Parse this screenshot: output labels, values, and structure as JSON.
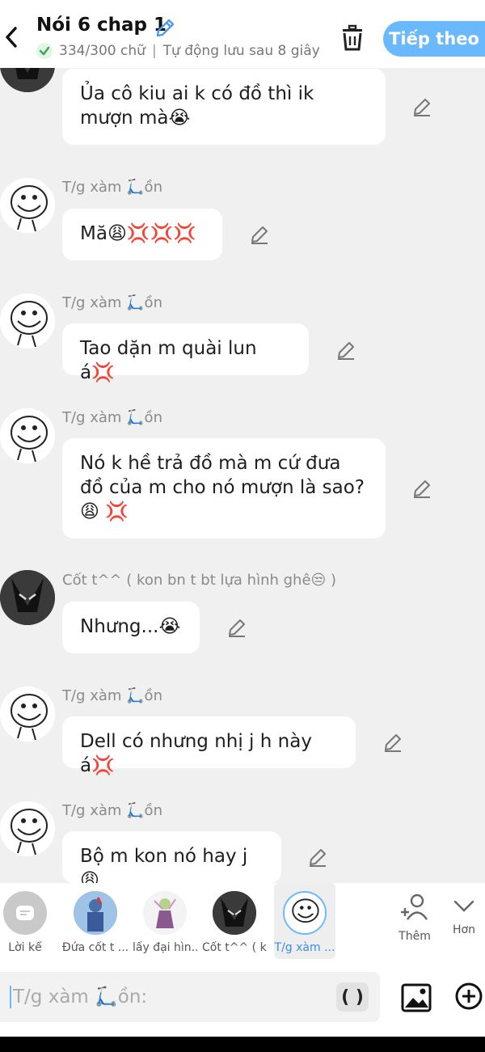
{
  "header": {
    "title": "Nói 6 chap 1",
    "subtitle_count": "334/300 chữ",
    "subtitle_sep": "|",
    "subtitle_autosave": "Tự động lưu sau 8 giây",
    "next_label": "Tiếp theo"
  },
  "messages": [
    {
      "sender": "",
      "text": "Ủa cô kiu ai k có đồ thì ik mượn mà😭",
      "avatar": "dark-mask-avatar"
    },
    {
      "sender": "T/g xàm 🛴ồn",
      "text": "Mă😩💢💢💢",
      "avatar": "troll-sketch-avatar"
    },
    {
      "sender": "T/g xàm 🛴ồn",
      "text": "Tao dặn m quài lun á💢",
      "avatar": "troll-sketch-avatar"
    },
    {
      "sender": "T/g xàm 🛴ồn",
      "text": "Nó k hề trả đồ mà m cứ đưa đồ của m cho nó mượn là sao?😩 💢",
      "avatar": "troll-sketch-avatar"
    },
    {
      "sender": "Cốt t^^ ( kon bn t bt lựa hình ghê😒 )",
      "text": "Nhưng...😭",
      "avatar": "dark-mask-avatar"
    },
    {
      "sender": "T/g xàm 🛴ồn",
      "text": "Dell có nhưng nhị j h này á💢",
      "avatar": "troll-sketch-avatar"
    },
    {
      "sender": "T/g xàm 🛴ồn",
      "text": "Bộ m kon nó hay j😩",
      "avatar": "troll-sketch-avatar"
    }
  ],
  "characters": [
    {
      "label": "Lời kể",
      "icon": "narration-icon"
    },
    {
      "label": "Đứa cốt t ...",
      "icon": "blue-character-avatar"
    },
    {
      "label": "lấy đại hìn...",
      "icon": "anime-character-avatar"
    },
    {
      "label": "Cốt t^^ ( k...",
      "icon": "dark-mask-avatar"
    },
    {
      "label": "T/g xàm ...",
      "icon": "troll-sketch-avatar",
      "selected": true
    }
  ],
  "more_label": "Thêm",
  "less_label": "Hơn",
  "input": {
    "placeholder": "T/g xàm 🛴ồn:",
    "paren_label": "( )"
  },
  "colors": {
    "accent": "#6ab9ff",
    "background": "#f0f0f0",
    "bubble": "#ffffff"
  }
}
